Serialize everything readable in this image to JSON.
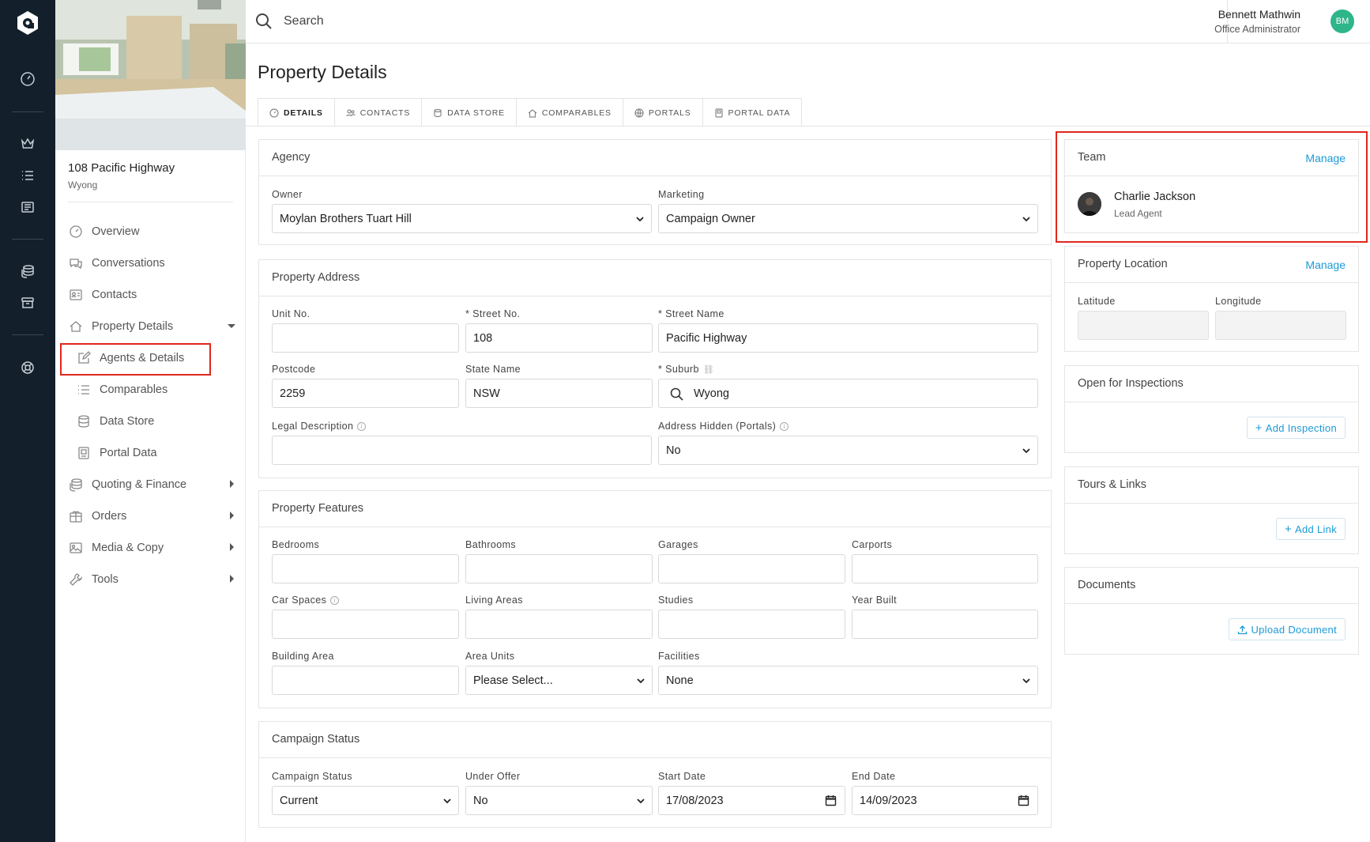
{
  "search": {
    "placeholder": "Search"
  },
  "user": {
    "name": "Bennett Mathwin",
    "role": "Office Administrator",
    "initials": "BM"
  },
  "property": {
    "address": "108 Pacific Highway",
    "suburb": "Wyong"
  },
  "sidebar": {
    "items": [
      {
        "label": "Overview",
        "icon": "gauge-icon"
      },
      {
        "label": "Conversations",
        "icon": "chat-icon"
      },
      {
        "label": "Contacts",
        "icon": "contact-card-icon"
      },
      {
        "label": "Property Details",
        "icon": "home-icon"
      },
      {
        "label": "Agents & Details",
        "icon": "edit-icon"
      },
      {
        "label": "Comparables",
        "icon": "list-icon"
      },
      {
        "label": "Data Store",
        "icon": "database-icon"
      },
      {
        "label": "Portal Data",
        "icon": "portal-icon"
      },
      {
        "label": "Quoting & Finance",
        "icon": "coins-icon"
      },
      {
        "label": "Orders",
        "icon": "box-icon"
      },
      {
        "label": "Media & Copy",
        "icon": "image-icon"
      },
      {
        "label": "Tools",
        "icon": "wrench-icon"
      }
    ]
  },
  "page": {
    "title": "Property Details"
  },
  "tabs": [
    "DETAILS",
    "CONTACTS",
    "DATA STORE",
    "COMPARABLES",
    "PORTALS",
    "PORTAL DATA"
  ],
  "agency": {
    "title": "Agency",
    "owner_label": "Owner",
    "owner_value": "Moylan Brothers Tuart Hill",
    "marketing_label": "Marketing",
    "marketing_value": "Campaign Owner"
  },
  "address": {
    "title": "Property Address",
    "unit_label": "Unit No.",
    "unit_value": "",
    "street_no_label": "* Street No.",
    "street_no_value": "108",
    "street_name_label": "* Street Name",
    "street_name_value": "Pacific Highway",
    "postcode_label": "Postcode",
    "postcode_value": "2259",
    "state_label": "State Name",
    "state_value": "NSW",
    "suburb_label": "* Suburb",
    "suburb_value": "Wyong",
    "legal_label": "Legal Description",
    "legal_value": "",
    "hidden_label": "Address Hidden (Portals)",
    "hidden_value": "No"
  },
  "features": {
    "title": "Property Features",
    "bedrooms": "Bedrooms",
    "bathrooms": "Bathrooms",
    "garages": "Garages",
    "carports": "Carports",
    "car_spaces": "Car Spaces",
    "living_areas": "Living Areas",
    "studies": "Studies",
    "year_built": "Year Built",
    "building_area": "Building Area",
    "area_units": "Area Units",
    "area_units_value": "Please Select...",
    "facilities": "Facilities",
    "facilities_value": "None"
  },
  "campaign": {
    "title": "Campaign Status",
    "status_label": "Campaign Status",
    "status_value": "Current",
    "offer_label": "Under Offer",
    "offer_value": "No",
    "start_label": "Start Date",
    "start_value": "17/08/2023",
    "end_label": "End Date",
    "end_value": "14/09/2023"
  },
  "team": {
    "title": "Team",
    "manage": "Manage",
    "agent_name": "Charlie Jackson",
    "agent_role": "Lead Agent"
  },
  "location": {
    "title": "Property Location",
    "manage": "Manage",
    "lat_label": "Latitude",
    "lng_label": "Longitude"
  },
  "inspections": {
    "title": "Open for Inspections",
    "button": "Add Inspection"
  },
  "tours": {
    "title": "Tours & Links",
    "button": "Add Link"
  },
  "documents": {
    "title": "Documents",
    "button": "Upload Document"
  },
  "colors": {
    "rail": "#13202b",
    "accent": "#1b9ad6",
    "highlight": "#e0281e",
    "avatar": "#2fb58a"
  }
}
